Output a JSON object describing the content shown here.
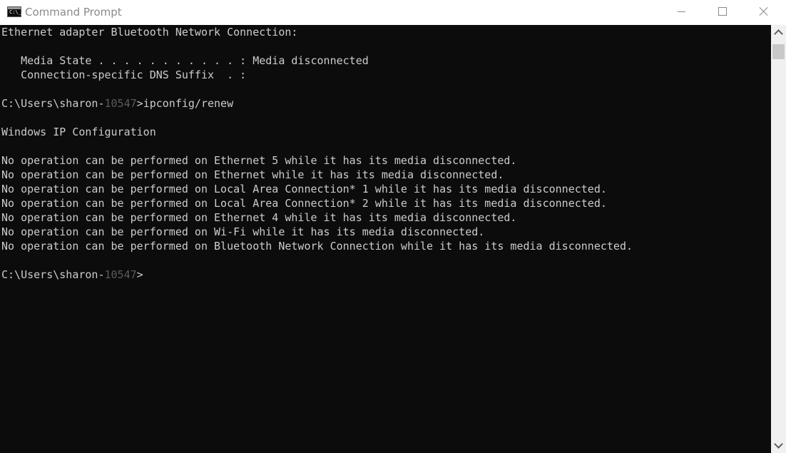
{
  "window": {
    "title": "Command Prompt",
    "icon": "cmd-icon",
    "icon_text": "C:\\_",
    "controls": {
      "minimize": "minimize-icon",
      "maximize": "maximize-icon",
      "close": "close-icon"
    }
  },
  "console": {
    "prompt_prefix": "C:\\Users\\sharon-",
    "prompt_user_id": "10547",
    "prompt_suffix": ">",
    "lines": [
      "Ethernet adapter Bluetooth Network Connection:",
      "",
      "   Media State . . . . . . . . . . . : Media disconnected",
      "   Connection-specific DNS Suffix  . :",
      "",
      "__PROMPT__ipconfig/renew",
      "",
      "Windows IP Configuration",
      "",
      "No operation can be performed on Ethernet 5 while it has its media disconnected.",
      "No operation can be performed on Ethernet while it has its media disconnected.",
      "No operation can be performed on Local Area Connection* 1 while it has its media disconnected.",
      "No operation can be performed on Local Area Connection* 2 while it has its media disconnected.",
      "No operation can be performed on Ethernet 4 while it has its media disconnected.",
      "No operation can be performed on Wi-Fi while it has its media disconnected.",
      "No operation can be performed on Bluetooth Network Connection while it has its media disconnected.",
      "",
      "__PROMPT__"
    ],
    "colors": {
      "background": "#0c0c0c",
      "text": "#cccccc",
      "dimmed": "#5a5a5a"
    }
  },
  "scrollbar": {
    "up_icon": "chevron-up-icon",
    "down_icon": "chevron-down-icon"
  }
}
